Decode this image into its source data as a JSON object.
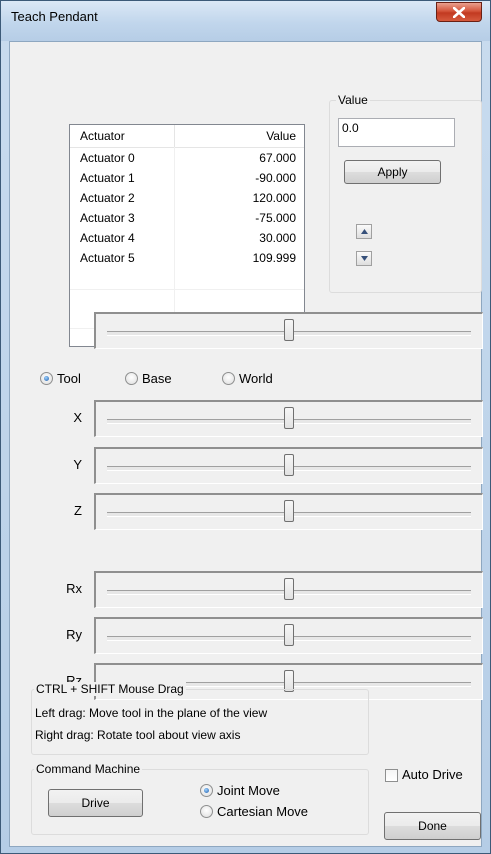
{
  "window": {
    "title": "Teach Pendant",
    "close_icon": "close-x-icon"
  },
  "actuator_table": {
    "headers": [
      "Actuator",
      "Value"
    ],
    "rows": [
      {
        "name": "Actuator 0",
        "value": "67.000"
      },
      {
        "name": "Actuator 1",
        "value": "-90.000"
      },
      {
        "name": "Actuator 2",
        "value": "120.000"
      },
      {
        "name": "Actuator 3",
        "value": "-75.000"
      },
      {
        "name": "Actuator 4",
        "value": "30.000"
      },
      {
        "name": "Actuator 5",
        "value": "109.999"
      }
    ]
  },
  "value_group": {
    "title": "Value",
    "input_value": "0.0",
    "apply_label": "Apply",
    "spin_up_icon": "arrow-up-icon",
    "spin_down_icon": "arrow-down-icon"
  },
  "actuator_slider": {
    "level": 0.5
  },
  "frame": {
    "options": [
      {
        "label": "Tool",
        "checked": true
      },
      {
        "label": "Base",
        "checked": false
      },
      {
        "label": "World",
        "checked": false
      }
    ]
  },
  "axes": [
    {
      "label": "X",
      "level": 0.5
    },
    {
      "label": "Y",
      "level": 0.5
    },
    {
      "label": "Z",
      "level": 0.5
    },
    {
      "label": "Rx",
      "level": 0.5
    },
    {
      "label": "Ry",
      "level": 0.5
    },
    {
      "label": "Rz",
      "level": 0.5
    }
  ],
  "mouse_help": {
    "title": "CTRL + SHIFT Mouse Drag",
    "line1": "Left drag:  Move tool in the plane of the view",
    "line2": "Right drag:  Rotate tool about view axis"
  },
  "command_machine": {
    "title": "Command Machine",
    "drive_label": "Drive",
    "options": [
      {
        "label": "Joint Move",
        "checked": true
      },
      {
        "label": "Cartesian Move",
        "checked": false
      }
    ]
  },
  "auto_drive": {
    "label": "Auto Drive",
    "checked": false
  },
  "done_label": "Done"
}
